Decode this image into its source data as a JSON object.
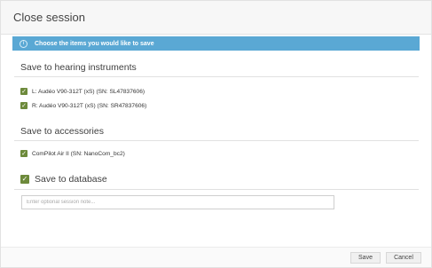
{
  "dialog": {
    "title": "Close session"
  },
  "banner": {
    "icon": "info-icon",
    "text": "Choose the items you would like to save"
  },
  "hearing": {
    "heading": "Save to hearing instruments",
    "items": [
      {
        "label": "L: Audéo V90-312T (xS) (SN: SL47837606)",
        "checked": true
      },
      {
        "label": "R: Audéo V90-312T (xS) (SN: SR47837606)",
        "checked": true
      }
    ]
  },
  "accessories": {
    "heading": "Save to accessories",
    "items": [
      {
        "label": "ComPilot Air II (SN: NanoCom_bc2)",
        "checked": true
      }
    ]
  },
  "database": {
    "label": "Save to database",
    "checked": true,
    "notes_placeholder": "Enter optional session note...",
    "notes_value": ""
  },
  "footer": {
    "save_label": "Save",
    "cancel_label": "Cancel"
  },
  "colors": {
    "banner": "#5aa8d4",
    "checkbox": "#6d8a3b"
  }
}
